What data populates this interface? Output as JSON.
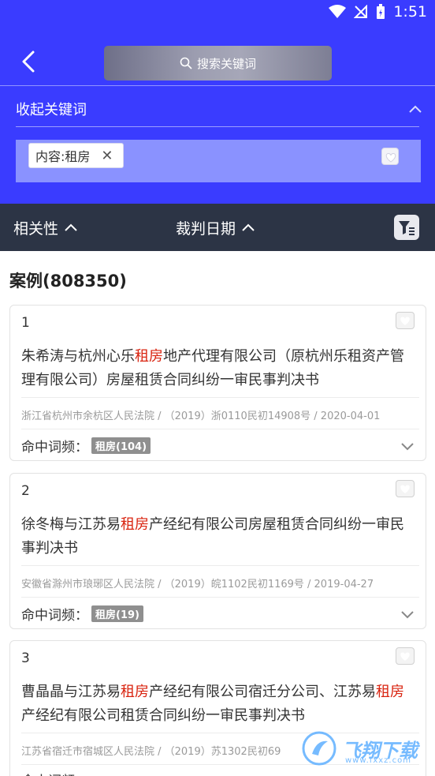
{
  "status": {
    "time": "1:51"
  },
  "search": {
    "placeholder": "搜索关键词"
  },
  "keywords": {
    "collapse_label": "收起关键词",
    "tag_label": "内容:租房"
  },
  "sort": {
    "relevance": "相关性",
    "date": "裁判日期"
  },
  "results": {
    "count_label": "案例(808350)",
    "hit_label": "命中词频：",
    "cards": [
      {
        "index": "1",
        "title_a": "朱希涛与杭州心乐",
        "title_hl": "租房",
        "title_b": "地产代理有限公司（原杭州乐租资产管理有限公司）房屋租赁合同纠纷一审民事判决书",
        "meta": "浙江省杭州市余杭区人民法院 / （2019）浙0110民初14908号 / 2020-04-01",
        "hit": "租房(104)"
      },
      {
        "index": "2",
        "title_a": "徐冬梅与江苏易",
        "title_hl": "租房",
        "title_b": "产经纪有限公司房屋租赁合同纠纷一审民事判决书",
        "meta": "安徽省滁州市琅琊区人民法院 / （2019）皖1102民初1169号 / 2019-04-27",
        "hit": "租房(19)"
      },
      {
        "index": "3",
        "title_a": "曹晶晶与江苏易",
        "title_hl": "租房",
        "title_b": "产经纪有限公司宿迁分公司、江苏易",
        "title_hl2": "租房",
        "title_c": "产经纪有限公司租赁合同纠纷一审民事判决书",
        "meta": "江苏省宿迁市宿城区人民法院 / （2019）苏1302民初69",
        "hit_label": "命中词频："
      }
    ]
  },
  "watermark": {
    "text": "飞翔下载",
    "sub": "www.fxxz.com"
  }
}
